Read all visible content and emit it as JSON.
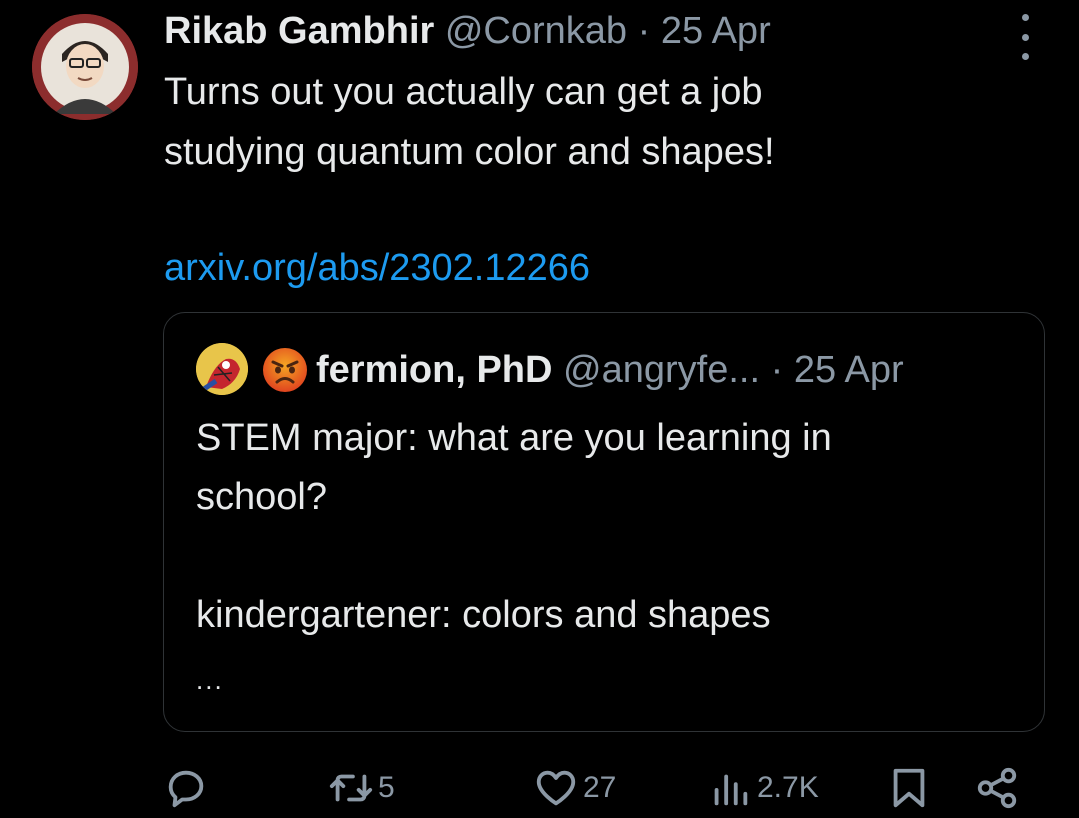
{
  "tweet": {
    "author_name": "Rikab Gambhir",
    "handle": "@Cornkab",
    "separator": "·",
    "date": "25 Apr",
    "text": "Turns out you actually can get a job\nstudying quantum color and shapes!",
    "link": "arxiv.org/abs/2302.12266"
  },
  "quote": {
    "author_name": "fermion, PhD",
    "handle": "@angryfe...",
    "separator": "·",
    "date": "25 Apr",
    "text": "STEM major: what are you learning in\nschool?\n\nkindergartener: colors and shapes",
    "truncation": "..."
  },
  "actions": {
    "replies_icon": "reply-icon",
    "retweets": "5",
    "likes": "27",
    "views": "2.7K"
  },
  "colors": {
    "background": "#000000",
    "text": "#e7e9ea",
    "muted": "#8b98a5",
    "link": "#1d9bf0",
    "border": "#2f3336"
  }
}
